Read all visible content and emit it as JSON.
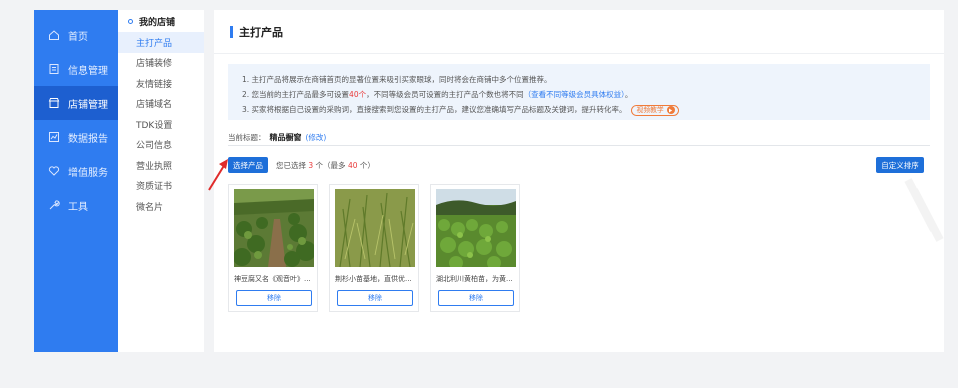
{
  "sidebar": {
    "items": [
      {
        "label": "首页",
        "icon": "home-icon"
      },
      {
        "label": "信息管理",
        "icon": "document-icon"
      },
      {
        "label": "店铺管理",
        "icon": "store-icon",
        "active": true
      },
      {
        "label": "数据报告",
        "icon": "chart-icon"
      },
      {
        "label": "增值服务",
        "icon": "heart-icon"
      },
      {
        "label": "工具",
        "icon": "wrench-icon"
      }
    ]
  },
  "subnav": {
    "title": "我的店铺",
    "items": [
      {
        "label": "主打产品",
        "active": true
      },
      {
        "label": "店铺装修"
      },
      {
        "label": "友情链接"
      },
      {
        "label": "店铺域名"
      },
      {
        "label": "TDK设置"
      },
      {
        "label": "公司信息"
      },
      {
        "label": "营业执照"
      },
      {
        "label": "资质证书"
      },
      {
        "label": "微名片"
      }
    ]
  },
  "main": {
    "title": "主打产品",
    "notice": {
      "line1": "1. 主打产品将展示在商铺首页的显著位置来吸引买家眼球，同时将会在商铺中多个位置推荐。",
      "line2_pre": "2. 您当前的主打产品最多可设置",
      "line2_count": "40个",
      "line2_mid": "，不同等级会员可设置的主打产品个数也将不同",
      "line2_link": "（查看不同等级会员具体权益）",
      "line2_end": "。",
      "line3": "3. 买家将根据自己设置的采购词，直接搜索到您设置的主打产品，建议您准确填写产品标题及关键词，提升转化率。",
      "video_label": "视频教学"
    },
    "current_title": {
      "label": "当前标题：",
      "value": "精品橱窗",
      "edit": "(修改)"
    },
    "select_button": "选择产品",
    "selected_pre": "您已选择 ",
    "selected_count": "3",
    "selected_mid": " 个（最多 ",
    "selected_max": "40",
    "selected_end": " 个）",
    "custom_sort_button": "自定义排序",
    "products": [
      {
        "name": "神豆腐又名《观音叶》...",
        "remove": "移除"
      },
      {
        "name": "荆杉小苗基地，直供优...",
        "remove": "移除"
      },
      {
        "name": "湖北利川黄柏苗，为黄...",
        "remove": "移除"
      }
    ]
  },
  "colors": {
    "accent": "#2f7cf0",
    "sidebar_active": "#1d5fd0",
    "warning": "#e93a3a",
    "video_tag": "#f07b3a"
  }
}
